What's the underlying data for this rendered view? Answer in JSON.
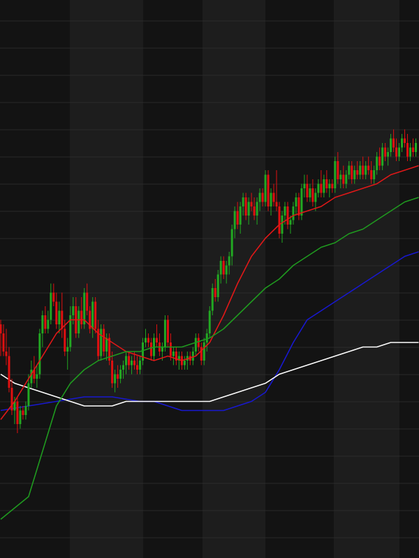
{
  "colors": {
    "background": "#131313",
    "band_alt": "#1d1d1d",
    "grid": "#2a2a2a",
    "candle_up": "#22a822",
    "candle_down": "#e01010",
    "ma_red": "#e01818",
    "ma_green": "#1f9a1f",
    "ma_blue": "#1818d0",
    "ma_white": "#ffffff"
  },
  "chart_data": {
    "type": "candlestick",
    "title": "",
    "xlabel": "",
    "ylabel": "",
    "grid": true,
    "legend": "none",
    "x_range": [
      0,
      150
    ],
    "ylim": [
      0,
      100
    ],
    "candles": [
      [
        0,
        54,
        55,
        47,
        52
      ],
      [
        1,
        52,
        54,
        47,
        48
      ],
      [
        2,
        48,
        53,
        45,
        47
      ],
      [
        3,
        47,
        49,
        39,
        40
      ],
      [
        4,
        40,
        42,
        34,
        35
      ],
      [
        5,
        35,
        38,
        32,
        37
      ],
      [
        6,
        37,
        38,
        30,
        32
      ],
      [
        7,
        32,
        36,
        31,
        35
      ],
      [
        8,
        35,
        36,
        33,
        34
      ],
      [
        9,
        34,
        37,
        33,
        36
      ],
      [
        10,
        36,
        43,
        35,
        41
      ],
      [
        11,
        41,
        46,
        40,
        44
      ],
      [
        12,
        44,
        47,
        41,
        42
      ],
      [
        13,
        42,
        45,
        40,
        43
      ],
      [
        14,
        43,
        53,
        42,
        52
      ],
      [
        15,
        52,
        57,
        49,
        56
      ],
      [
        16,
        56,
        58,
        52,
        53
      ],
      [
        17,
        53,
        57,
        52,
        55
      ],
      [
        18,
        55,
        63,
        54,
        61
      ],
      [
        19,
        61,
        63,
        58,
        59
      ],
      [
        20,
        59,
        61,
        53,
        54
      ],
      [
        21,
        54,
        59,
        52,
        57
      ],
      [
        22,
        57,
        61,
        51,
        53
      ],
      [
        23,
        53,
        55,
        47,
        48
      ],
      [
        24,
        48,
        51,
        44,
        49
      ],
      [
        25,
        49,
        58,
        48,
        56
      ],
      [
        26,
        56,
        60,
        54,
        58
      ],
      [
        27,
        58,
        60,
        51,
        52
      ],
      [
        28,
        52,
        58,
        51,
        57
      ],
      [
        29,
        57,
        60,
        53,
        54
      ],
      [
        30,
        54,
        62,
        53,
        61
      ],
      [
        31,
        61,
        63,
        56,
        57
      ],
      [
        32,
        57,
        58,
        52,
        53
      ],
      [
        33,
        53,
        60,
        51,
        59
      ],
      [
        34,
        59,
        60,
        52,
        53
      ],
      [
        35,
        53,
        55,
        46,
        47
      ],
      [
        36,
        47,
        54,
        46,
        53
      ],
      [
        37,
        53,
        54,
        47,
        48
      ],
      [
        38,
        48,
        52,
        46,
        51
      ],
      [
        39,
        51,
        52,
        45,
        46
      ],
      [
        40,
        46,
        48,
        40,
        41
      ],
      [
        41,
        41,
        44,
        39,
        43
      ],
      [
        42,
        43,
        45,
        40,
        42
      ],
      [
        43,
        42,
        45,
        41,
        44
      ],
      [
        44,
        44,
        46,
        42,
        45
      ],
      [
        45,
        45,
        48,
        43,
        47
      ],
      [
        46,
        47,
        48,
        44,
        45
      ],
      [
        47,
        45,
        47,
        43,
        46
      ],
      [
        48,
        46,
        48,
        44,
        45
      ],
      [
        49,
        45,
        47,
        43,
        44
      ],
      [
        50,
        44,
        47,
        43,
        46
      ],
      [
        51,
        46,
        51,
        45,
        50
      ],
      [
        52,
        50,
        53,
        49,
        51
      ],
      [
        53,
        51,
        52,
        49,
        50
      ],
      [
        54,
        50,
        51,
        46,
        47
      ],
      [
        55,
        47,
        52,
        46,
        51
      ],
      [
        56,
        51,
        54,
        49,
        50
      ],
      [
        57,
        50,
        52,
        47,
        48
      ],
      [
        58,
        48,
        50,
        46,
        49
      ],
      [
        59,
        49,
        56,
        48,
        55
      ],
      [
        60,
        55,
        56,
        49,
        50
      ],
      [
        61,
        50,
        52,
        46,
        47
      ],
      [
        62,
        47,
        49,
        45,
        48
      ],
      [
        63,
        48,
        49,
        45,
        46
      ],
      [
        64,
        46,
        48,
        44,
        47
      ],
      [
        65,
        47,
        48,
        44,
        45
      ],
      [
        66,
        45,
        47,
        44,
        46
      ],
      [
        67,
        46,
        48,
        44,
        47
      ],
      [
        68,
        47,
        48,
        45,
        46
      ],
      [
        69,
        46,
        49,
        45,
        48
      ],
      [
        70,
        48,
        52,
        47,
        51
      ],
      [
        71,
        51,
        52,
        48,
        49
      ],
      [
        72,
        49,
        50,
        45,
        46
      ],
      [
        73,
        46,
        51,
        45,
        50
      ],
      [
        74,
        50,
        53,
        48,
        52
      ],
      [
        75,
        52,
        58,
        51,
        57
      ],
      [
        76,
        57,
        63,
        56,
        62
      ],
      [
        77,
        62,
        64,
        59,
        60
      ],
      [
        78,
        60,
        66,
        59,
        65
      ],
      [
        79,
        65,
        69,
        63,
        68
      ],
      [
        80,
        68,
        69,
        64,
        65
      ],
      [
        81,
        65,
        68,
        63,
        67
      ],
      [
        82,
        67,
        70,
        65,
        69
      ],
      [
        83,
        69,
        76,
        67,
        75
      ],
      [
        84,
        75,
        80,
        73,
        79
      ],
      [
        85,
        79,
        81,
        75,
        76
      ],
      [
        86,
        76,
        81,
        74,
        80
      ],
      [
        87,
        80,
        83,
        78,
        82
      ],
      [
        88,
        82,
        83,
        77,
        78
      ],
      [
        89,
        78,
        82,
        76,
        81
      ],
      [
        90,
        81,
        83,
        79,
        80
      ],
      [
        91,
        80,
        82,
        77,
        78
      ],
      [
        92,
        78,
        82,
        76,
        81
      ],
      [
        93,
        81,
        84,
        79,
        83
      ],
      [
        94,
        83,
        84,
        80,
        81
      ],
      [
        95,
        81,
        88,
        80,
        87
      ],
      [
        96,
        87,
        88,
        79,
        80
      ],
      [
        97,
        80,
        84,
        78,
        83
      ],
      [
        98,
        83,
        85,
        80,
        81
      ],
      [
        99,
        81,
        88,
        79,
        80
      ],
      [
        100,
        80,
        81,
        73,
        74
      ],
      [
        101,
        74,
        79,
        72,
        78
      ],
      [
        102,
        78,
        81,
        76,
        80
      ],
      [
        103,
        80,
        81,
        75,
        76
      ],
      [
        104,
        76,
        78,
        74,
        77
      ],
      [
        105,
        77,
        81,
        76,
        80
      ],
      [
        106,
        80,
        83,
        78,
        82
      ],
      [
        107,
        82,
        83,
        77,
        78
      ],
      [
        108,
        78,
        85,
        77,
        84
      ],
      [
        109,
        84,
        87,
        82,
        85
      ],
      [
        110,
        85,
        87,
        81,
        82
      ],
      [
        111,
        82,
        85,
        81,
        84
      ],
      [
        112,
        84,
        86,
        80,
        81
      ],
      [
        113,
        81,
        84,
        79,
        83
      ],
      [
        114,
        83,
        86,
        82,
        85
      ],
      [
        115,
        85,
        88,
        82,
        83
      ],
      [
        116,
        83,
        87,
        82,
        86
      ],
      [
        117,
        86,
        88,
        83,
        84
      ],
      [
        118,
        84,
        86,
        82,
        85
      ],
      [
        119,
        85,
        86,
        83,
        84
      ],
      [
        120,
        84,
        91,
        83,
        90
      ],
      [
        121,
        90,
        92,
        85,
        86
      ],
      [
        122,
        86,
        88,
        84,
        87
      ],
      [
        123,
        87,
        89,
        84,
        85
      ],
      [
        124,
        85,
        88,
        84,
        87
      ],
      [
        125,
        87,
        90,
        86,
        89
      ],
      [
        126,
        89,
        90,
        85,
        86
      ],
      [
        127,
        86,
        89,
        85,
        88
      ],
      [
        128,
        88,
        90,
        86,
        87
      ],
      [
        129,
        87,
        90,
        86,
        89
      ],
      [
        130,
        89,
        91,
        86,
        87
      ],
      [
        131,
        87,
        90,
        86,
        89
      ],
      [
        132,
        89,
        91,
        87,
        88
      ],
      [
        133,
        88,
        90,
        85,
        86
      ],
      [
        134,
        86,
        89,
        85,
        88
      ],
      [
        135,
        88,
        92,
        87,
        91
      ],
      [
        136,
        91,
        93,
        88,
        89
      ],
      [
        137,
        89,
        94,
        88,
        93
      ],
      [
        138,
        93,
        94,
        90,
        91
      ],
      [
        139,
        91,
        93,
        89,
        92
      ],
      [
        140,
        92,
        96,
        91,
        95
      ],
      [
        141,
        95,
        97,
        92,
        93
      ],
      [
        142,
        93,
        95,
        90,
        91
      ],
      [
        143,
        91,
        94,
        90,
        93
      ],
      [
        144,
        93,
        96,
        92,
        95
      ],
      [
        145,
        95,
        97,
        93,
        94
      ],
      [
        146,
        94,
        96,
        90,
        91
      ],
      [
        147,
        91,
        94,
        90,
        93
      ],
      [
        148,
        93,
        95,
        91,
        92
      ],
      [
        149,
        92,
        95,
        91,
        94
      ]
    ],
    "moving_averages": [
      {
        "color_key": "ma_red",
        "x": [
          0,
          5,
          10,
          15,
          20,
          25,
          30,
          35,
          40,
          45,
          50,
          55,
          60,
          65,
          70,
          75,
          80,
          85,
          90,
          95,
          100,
          105,
          110,
          115,
          120,
          125,
          130,
          135,
          140,
          145,
          150
        ],
        "y": [
          33,
          37,
          42,
          47,
          52,
          55,
          55,
          52,
          50,
          48,
          47,
          46,
          47,
          46,
          47,
          50,
          56,
          63,
          69,
          73,
          76,
          78,
          79,
          80,
          82,
          83,
          84,
          85,
          87,
          88,
          89
        ]
      },
      {
        "color_key": "ma_green",
        "x": [
          0,
          10,
          15,
          20,
          25,
          30,
          35,
          40,
          45,
          50,
          55,
          60,
          65,
          70,
          75,
          80,
          85,
          90,
          95,
          100,
          105,
          110,
          115,
          120,
          125,
          130,
          135,
          140,
          145,
          150
        ],
        "y": [
          11,
          16,
          26,
          36,
          41,
          44,
          46,
          47,
          48,
          48,
          49,
          49,
          49,
          50,
          51,
          53,
          56,
          59,
          62,
          64,
          67,
          69,
          71,
          72,
          74,
          75,
          77,
          79,
          81,
          82
        ]
      },
      {
        "color_key": "ma_blue",
        "x": [
          0,
          10,
          20,
          30,
          40,
          50,
          55,
          60,
          65,
          70,
          75,
          80,
          85,
          90,
          95,
          100,
          105,
          110,
          115,
          120,
          125,
          130,
          135,
          140,
          145,
          150
        ],
        "y": [
          35,
          36,
          37,
          38,
          38,
          37,
          37,
          36,
          35,
          35,
          35,
          35,
          36,
          37,
          39,
          44,
          50,
          55,
          57,
          59,
          61,
          63,
          65,
          67,
          69,
          70
        ]
      },
      {
        "color_key": "ma_white",
        "x": [
          0,
          5,
          10,
          15,
          20,
          25,
          30,
          35,
          40,
          45,
          50,
          55,
          60,
          65,
          70,
          75,
          80,
          85,
          90,
          95,
          100,
          105,
          110,
          115,
          120,
          125,
          130,
          135,
          140,
          145,
          150
        ],
        "y": [
          43,
          41,
          40,
          39,
          38,
          37,
          36,
          36,
          36,
          37,
          37,
          37,
          37,
          37,
          37,
          37,
          38,
          39,
          40,
          41,
          43,
          44,
          45,
          46,
          47,
          48,
          49,
          49,
          50,
          50,
          50
        ]
      }
    ]
  }
}
